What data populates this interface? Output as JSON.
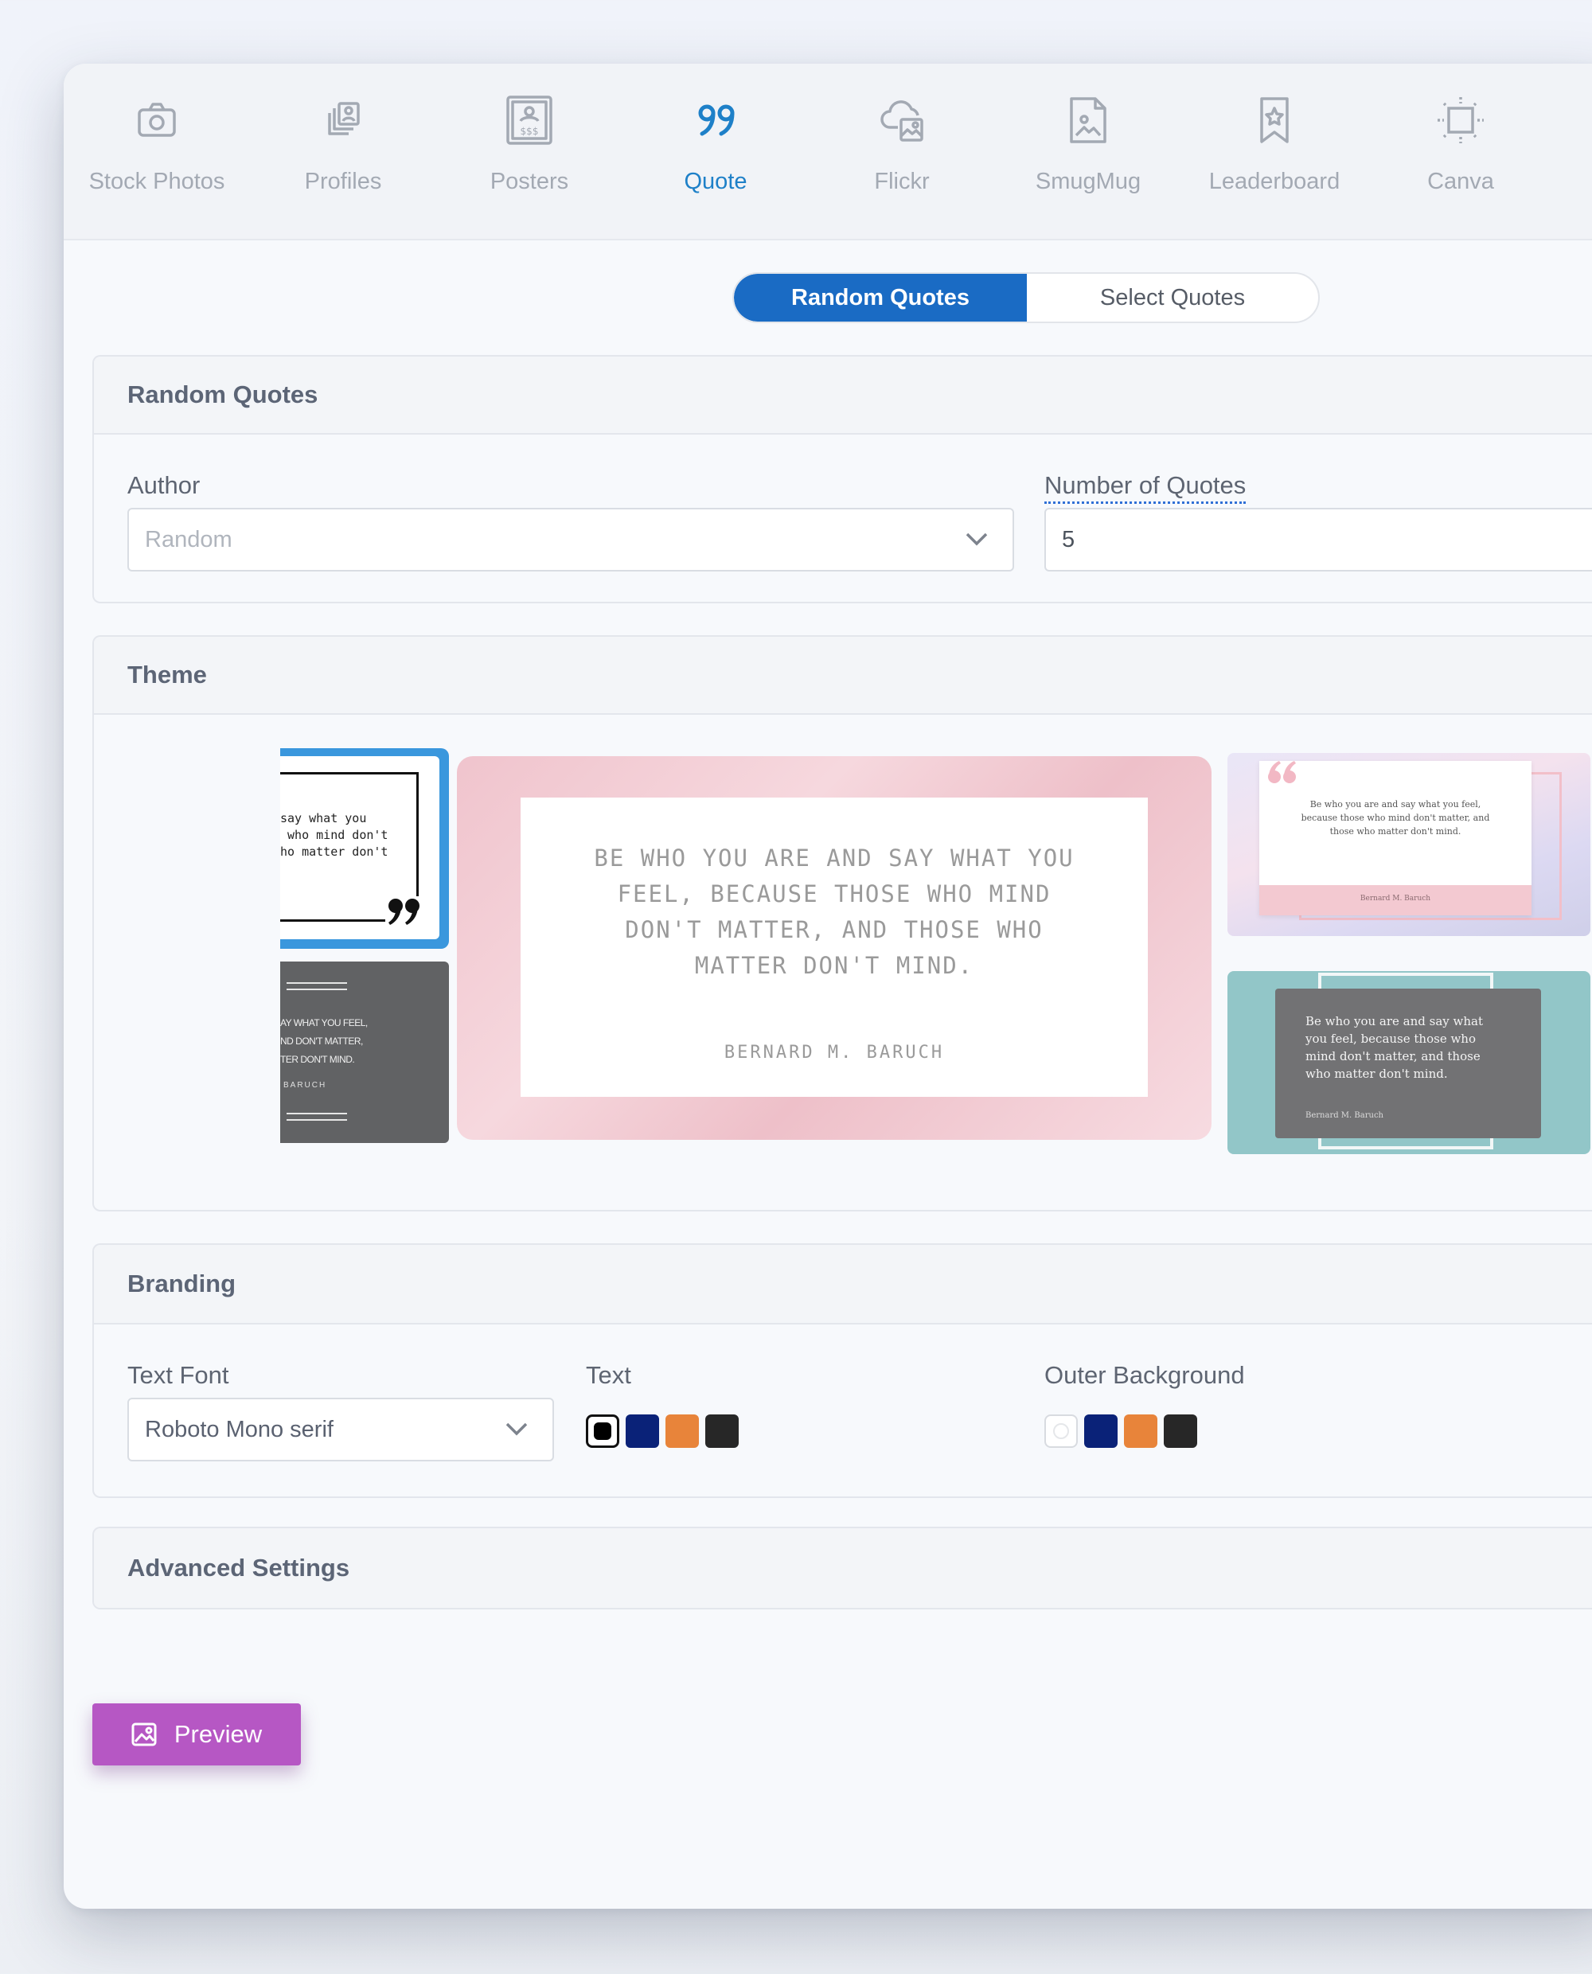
{
  "toolbar": {
    "items": [
      {
        "label": "Stock Photos",
        "icon": "camera-icon"
      },
      {
        "label": "Profiles",
        "icon": "profiles-icon"
      },
      {
        "label": "Posters",
        "icon": "poster-icon"
      },
      {
        "label": "Quote",
        "icon": "quote-icon",
        "active": true
      },
      {
        "label": "Flickr",
        "icon": "cloud-image-icon"
      },
      {
        "label": "SmugMug",
        "icon": "image-file-icon"
      },
      {
        "label": "Leaderboard",
        "icon": "bookmark-star-icon"
      },
      {
        "label": "Canva",
        "icon": "crop-frame-icon"
      }
    ]
  },
  "mode_toggle": {
    "active": "Random Quotes",
    "inactive": "Select Quotes"
  },
  "random_quotes": {
    "title": "Random Quotes",
    "author_label": "Author",
    "author_value": "Random",
    "count_label": "Number of Quotes",
    "count_value": "5"
  },
  "theme": {
    "title": "Theme",
    "card_left_top_text": "say what you\n who mind don't\nho matter don't",
    "card_left_bottom_text": "AY WHAT YOU FEEL,\nND DON'T MATTER,\nTER DON'T MIND.",
    "card_left_bottom_author": "BARUCH",
    "main_quote": "BE WHO YOU ARE AND SAY WHAT YOU FEEL, BECAUSE THOSE WHO MIND DON'T MATTER, AND THOSE WHO MATTER DON'T MIND.",
    "main_author": "BERNARD M. BARUCH",
    "card_right_top_quote": "Be who you are and say what you feel, because those who mind don't matter, and those who matter don't mind.",
    "card_right_top_author": "Bernard M. Baruch",
    "card_right_bottom_quote": "Be who you are and say what you feel, because those who mind don't matter, and those who matter don't mind.",
    "card_right_bottom_author": "Bernard M. Baruch"
  },
  "branding": {
    "title": "Branding",
    "font_label": "Text Font",
    "font_value": "Roboto Mono serif",
    "text_label": "Text",
    "text_colors": [
      "#000000",
      "#0a2278",
      "#e8843a",
      "#272727"
    ],
    "outer_label": "Outer Background",
    "outer_colors": [
      "#ffffff",
      "#0a2278",
      "#e8843a",
      "#272727"
    ]
  },
  "advanced": {
    "title": "Advanced Settings"
  },
  "preview_button": {
    "label": "Preview"
  },
  "colors": {
    "accent": "#1a6bc4",
    "preview": "#b657c4"
  }
}
